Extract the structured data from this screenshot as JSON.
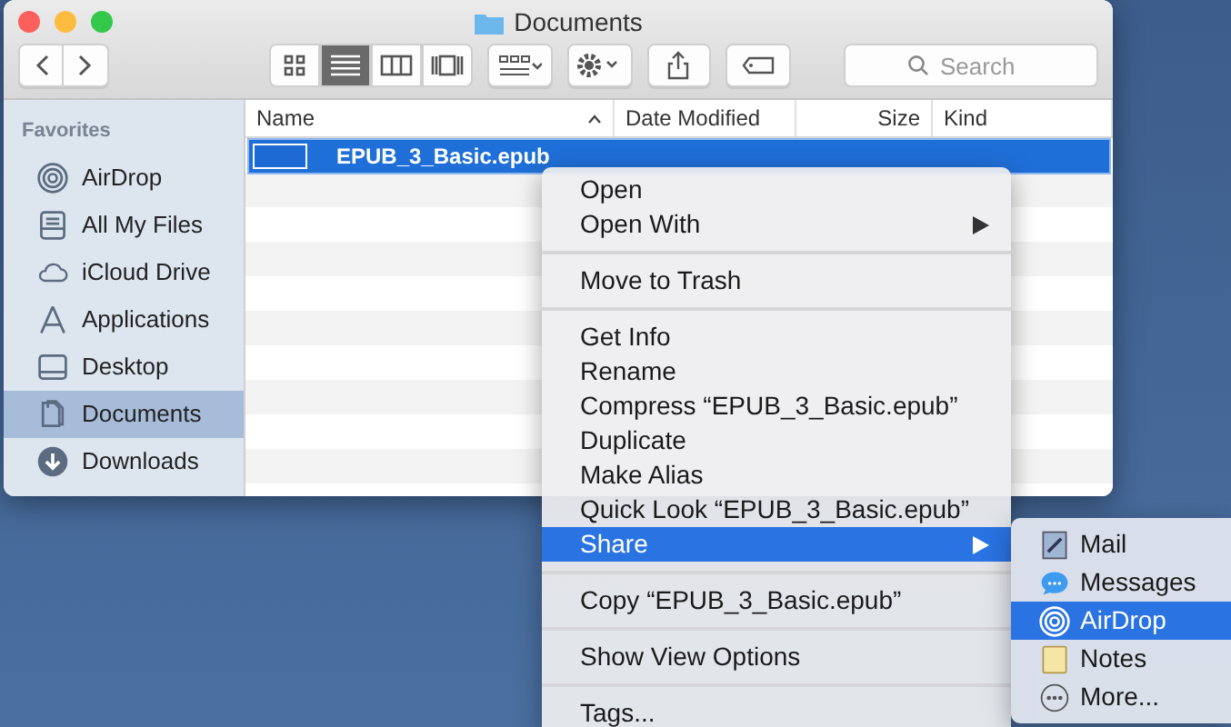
{
  "window": {
    "title": "Documents"
  },
  "toolbar": {
    "view_modes": [
      {
        "kind": "icons",
        "selected": false
      },
      {
        "kind": "list",
        "selected": true
      },
      {
        "kind": "columns",
        "selected": false
      },
      {
        "kind": "coverflow",
        "selected": false
      }
    ],
    "search": {
      "placeholder": "Search"
    }
  },
  "sidebar": {
    "heading": "Favorites",
    "items": [
      {
        "label": "AirDrop",
        "kind": "airdrop",
        "selected": false
      },
      {
        "label": "All My Files",
        "kind": "files",
        "selected": false
      },
      {
        "label": "iCloud Drive",
        "kind": "cloud",
        "selected": false
      },
      {
        "label": "Applications",
        "kind": "apps",
        "selected": false
      },
      {
        "label": "Desktop",
        "kind": "desktop",
        "selected": false
      },
      {
        "label": "Documents",
        "kind": "documents",
        "selected": true
      },
      {
        "label": "Downloads",
        "kind": "downloads",
        "selected": false
      }
    ]
  },
  "table": {
    "columns": [
      "Name",
      "Date Modified",
      "Size",
      "Kind"
    ],
    "rows": [
      {
        "name": "EPUB_3_Basic.epub",
        "selected": true
      }
    ]
  },
  "context_menu": [
    {
      "kind": "item",
      "label": "Open",
      "submenu": false,
      "selected": false
    },
    {
      "kind": "item",
      "label": "Open With",
      "submenu": true,
      "selected": false
    },
    {
      "kind": "separator"
    },
    {
      "kind": "item",
      "label": "Move to Trash",
      "submenu": false,
      "selected": false
    },
    {
      "kind": "separator"
    },
    {
      "kind": "item",
      "label": "Get Info",
      "submenu": false,
      "selected": false
    },
    {
      "kind": "item",
      "label": "Rename",
      "submenu": false,
      "selected": false
    },
    {
      "kind": "item",
      "label": "Compress “EPUB_3_Basic.epub”",
      "submenu": false,
      "selected": false
    },
    {
      "kind": "item",
      "label": "Duplicate",
      "submenu": false,
      "selected": false
    },
    {
      "kind": "item",
      "label": "Make Alias",
      "submenu": false,
      "selected": false
    },
    {
      "kind": "item",
      "label": "Quick Look “EPUB_3_Basic.epub”",
      "submenu": false,
      "selected": false
    },
    {
      "kind": "item",
      "label": "Share",
      "submenu": true,
      "selected": true
    },
    {
      "kind": "separator"
    },
    {
      "kind": "item",
      "label": "Copy “EPUB_3_Basic.epub”",
      "submenu": false,
      "selected": false
    },
    {
      "kind": "separator"
    },
    {
      "kind": "item",
      "label": "Show View Options",
      "submenu": false,
      "selected": false
    },
    {
      "kind": "separator"
    },
    {
      "kind": "item",
      "label": "Tags...",
      "submenu": false,
      "selected": false
    }
  ],
  "share_menu": [
    {
      "label": "Mail",
      "kind": "mail",
      "selected": false
    },
    {
      "label": "Messages",
      "kind": "messages",
      "selected": false
    },
    {
      "label": "AirDrop",
      "kind": "airdrop",
      "selected": true
    },
    {
      "label": "Notes",
      "kind": "notes",
      "selected": false
    },
    {
      "label": "More...",
      "kind": "more",
      "selected": false
    }
  ]
}
